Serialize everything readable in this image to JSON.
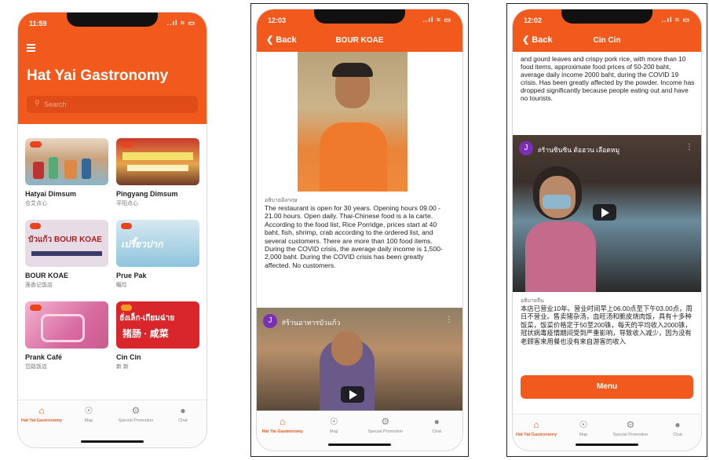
{
  "phone1": {
    "time": "11:59",
    "title": "Hat Yai Gastronomy",
    "search_placeholder": "Search",
    "menu_icon": "hamburger-icon",
    "cards": [
      {
        "name": "Hatyai Dimsum",
        "sub": "合艾点心"
      },
      {
        "name": "Pingyang Dimsum",
        "sub": "平阳点心"
      },
      {
        "name": "BOUR KOAE",
        "sub": "莲香记饭店"
      },
      {
        "name": "Prue Pak",
        "sub": "瞩珍"
      },
      {
        "name": "Prank Café",
        "sub": "岱路饭店"
      },
      {
        "name": "Cin Cin",
        "sub": "新 新"
      }
    ],
    "card_signs": [
      "บัวแก้ว BOUR KOAE",
      "เปรี้ยวปาก",
      "ฮั่งเล็ก-เกียมฉ่าย",
      "猪肠 · 咸菜"
    ]
  },
  "phone2": {
    "time": "12:03",
    "back": "Back",
    "title": "BOUR KOAE",
    "caption": "อธิบายอังกฤษ",
    "body": "The restaurant is open for 30 years. Opening hours 09.00 - 21.00 hours. Open daily. Thai-Chinese food is a la carte. According to the food list, Rice Porridge, prices start at 40 baht, fish, shrimp, crab according to the ordered list, and several customers. There are more than 100 food items. During the COVID crisis, the average daily income is 1,500-2,000 baht. During the COVID crisis has been greatly affected. No customers.",
    "video_avatar": "J",
    "video_title": "#ร้านอาหารบัวแก้ว"
  },
  "phone3": {
    "time": "12:02",
    "back": "Back",
    "title": "Cin Cin",
    "top_text": "and gourd leaves and crispy pork rice, with more than 10 food items, approximate food prices of 50-200 baht, average daily income 2000 baht, during the COVID 19 crisis. Has been greatly affected by the powder. Income has dropped significantly because people eating out and have no tourists.",
    "video_avatar": "J",
    "video_title": "#ร้านซินซิน ต้อฮวน เลือดหมู",
    "caption": "อธิบายจีน",
    "chinese": "本店已营业10年。营业时间早上06.00点至下午03.00点，周日不营业。售卖猪杂汤，血旺汤和脆皮烧肉饭，具有十多种饭菜，饭菜价格定于50至200铢，每天的平均收入2000铢，冠状病毒疫情期间受到严重影响，导致收入减少，因为没有老顾客来用餐也没有来自游客的收入",
    "menu_button": "Menu"
  },
  "tabs": [
    "Hat Yai Gastronomy",
    "Map",
    "Special Promotion",
    "Chat"
  ],
  "status_signal": "..ıl ≈ ▭",
  "colors": {
    "accent": "#f25a1d",
    "video_bg": "#1d1d1d"
  }
}
